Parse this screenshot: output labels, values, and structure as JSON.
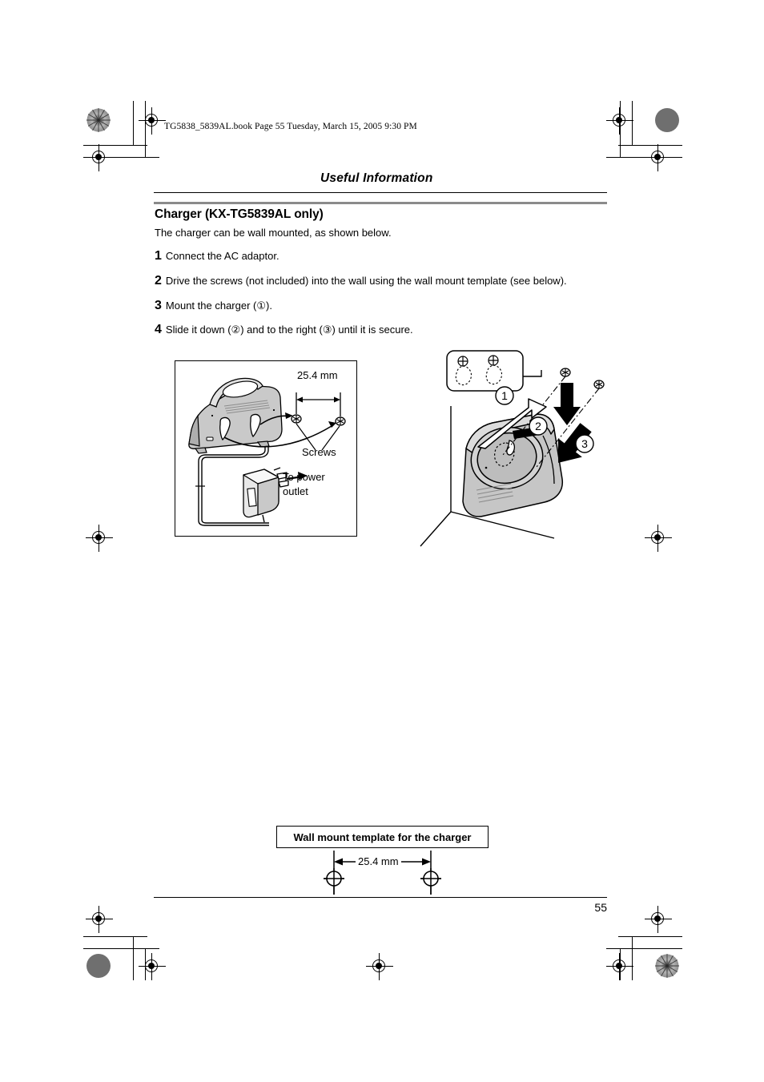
{
  "document": {
    "filename_line": "TG5838_5839AL.book  Page 55  Tuesday, March 15, 2005  9:30 PM",
    "running_head": "Useful Information",
    "page_number": "55"
  },
  "section": {
    "title": "Charger (KX-TG5839AL only)",
    "intro": "The charger can be wall mounted, as shown below."
  },
  "steps": [
    {
      "number": "1",
      "text": "Connect the AC adaptor."
    },
    {
      "number": "2",
      "text": "Drive the screws (not included) into the wall using the wall mount template (see below)."
    },
    {
      "number": "3",
      "text": "Mount the charger (①)."
    },
    {
      "number": "4",
      "text": "Slide it down (②) and to the right (③) until it is secure."
    }
  ],
  "figure_left": {
    "dimension_label": "25.4 mm",
    "screws_label": "Screws",
    "power_label_line1": "To power",
    "power_label_line2": "outlet"
  },
  "figure_right": {
    "callout_1": "①",
    "callout_2": "②",
    "callout_3": "③"
  },
  "wall_template": {
    "caption": "Wall mount template for the charger",
    "dimension_label": "25.4 mm"
  },
  "colors": {
    "ink": "#000000",
    "rule_gray": "#8b8b8b",
    "shade_light": "#d8d8d8",
    "shade_mid": "#b9b9b9",
    "shade_dark": "#9a9a9a"
  }
}
